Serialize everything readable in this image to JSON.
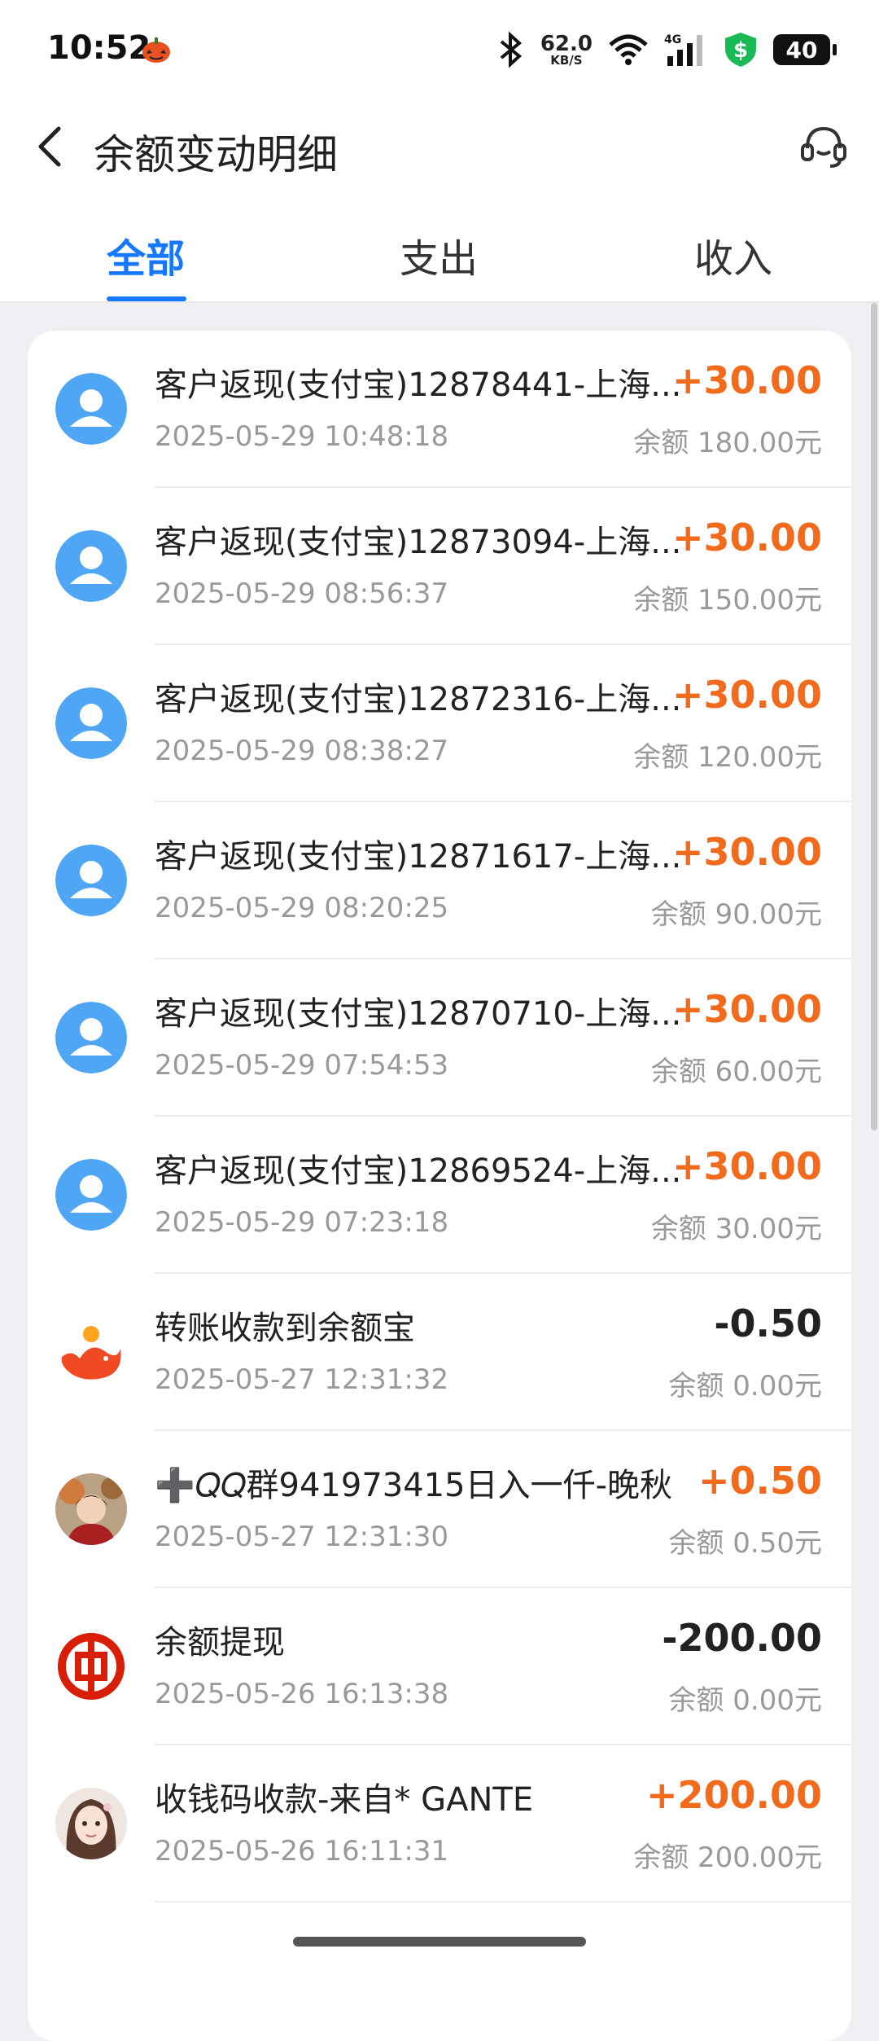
{
  "status_bar": {
    "time": "10:52",
    "net_speed": "62.0",
    "net_unit": "KB/S",
    "network": "4G",
    "battery": "40"
  },
  "header": {
    "title": "余额变动明细"
  },
  "tabs": [
    {
      "label": "全部",
      "active": true
    },
    {
      "label": "支出",
      "active": false
    },
    {
      "label": "收入",
      "active": false
    }
  ],
  "transactions": [
    {
      "title": "客户返现(支付宝)12878441-上海...",
      "time": "2025-05-29 10:48:18",
      "amount": "+30.00",
      "balance": "余额 180.00元",
      "icon": "user-avatar-icon"
    },
    {
      "title": "客户返现(支付宝)12873094-上海...",
      "time": "2025-05-29 08:56:37",
      "amount": "+30.00",
      "balance": "余额 150.00元",
      "icon": "user-avatar-icon"
    },
    {
      "title": "客户返现(支付宝)12872316-上海...",
      "time": "2025-05-29 08:38:27",
      "amount": "+30.00",
      "balance": "余额 120.00元",
      "icon": "user-avatar-icon"
    },
    {
      "title": "客户返现(支付宝)12871617-上海...",
      "time": "2025-05-29 08:20:25",
      "amount": "+30.00",
      "balance": "余额 90.00元",
      "icon": "user-avatar-icon"
    },
    {
      "title": "客户返现(支付宝)12870710-上海...",
      "time": "2025-05-29 07:54:53",
      "amount": "+30.00",
      "balance": "余额 60.00元",
      "icon": "user-avatar-icon"
    },
    {
      "title": "客户返现(支付宝)12869524-上海...",
      "time": "2025-05-29 07:23:18",
      "amount": "+30.00",
      "balance": "余额 30.00元",
      "icon": "user-avatar-icon"
    },
    {
      "title": "转账收款到余额宝",
      "time": "2025-05-27 12:31:32",
      "amount": "-0.50",
      "balance": "余额 0.00元",
      "icon": "yuebao-icon"
    },
    {
      "title": "➕𝑄𝑄群941973415日入一仟-晚秋",
      "time": "2025-05-27 12:31:30",
      "amount": "+0.50",
      "balance": "余额 0.50元",
      "icon": "photo-avatar-icon"
    },
    {
      "title": "余额提现",
      "time": "2025-05-26 16:13:38",
      "amount": "-200.00",
      "balance": "余额 0.00元",
      "icon": "bank-logo-icon"
    },
    {
      "title": "收钱码收款-来自* GANTE",
      "time": "2025-05-26 16:11:31",
      "amount": "+200.00",
      "balance": "余额 200.00元",
      "icon": "girl-avatar-icon"
    }
  ],
  "colors": {
    "accent": "#1677ff",
    "income": "#f26a1b",
    "expense": "#222222",
    "avatar_blue": "#4fa6f5"
  }
}
